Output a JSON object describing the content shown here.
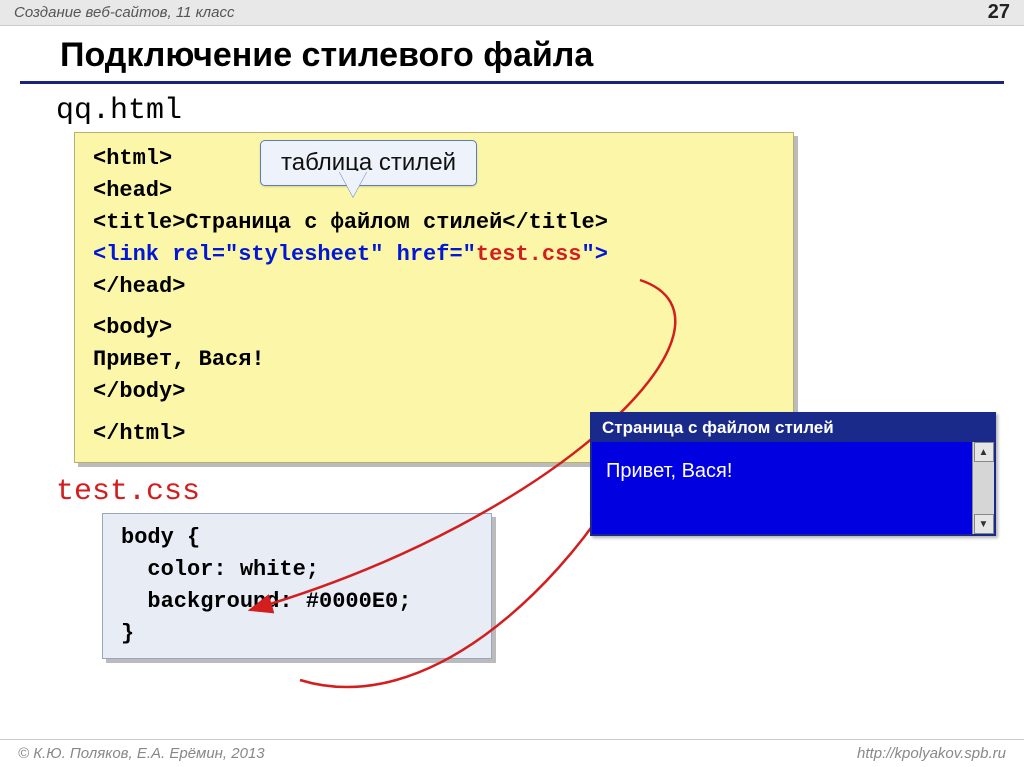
{
  "header": {
    "course": "Создание веб-сайтов, 11 класс",
    "page_number": "27"
  },
  "title": "Подключение стилевого файла",
  "callout": "таблица стилей",
  "html_file": {
    "name": "qq.html",
    "lines": {
      "l1": "<html>",
      "l2": "<head>",
      "l3a": "<title>",
      "l3b": "Страница с файлом стилей",
      "l3c": "</title>",
      "l4a": "<link rel=\"stylesheet\" href=\"",
      "l4b": "test.css",
      "l4c": "\">",
      "l5": "</head>",
      "l6": "<body>",
      "l7": "Привет, Вася!",
      "l8": "</body>",
      "l9": "</html>"
    }
  },
  "css_file": {
    "name": "test.css",
    "lines": {
      "l1": "body {",
      "l2": "  color: white;",
      "l3": "  background: #0000E0;",
      "l4": "}"
    }
  },
  "browser": {
    "title": "Страница с файлом стилей",
    "body": "Привет, Вася!",
    "scroll_up": "▲",
    "scroll_down": "▼"
  },
  "footer": {
    "left": "© К.Ю. Поляков, Е.А. Ерёмин, 2013",
    "right": "http://kpolyakov.spb.ru"
  }
}
